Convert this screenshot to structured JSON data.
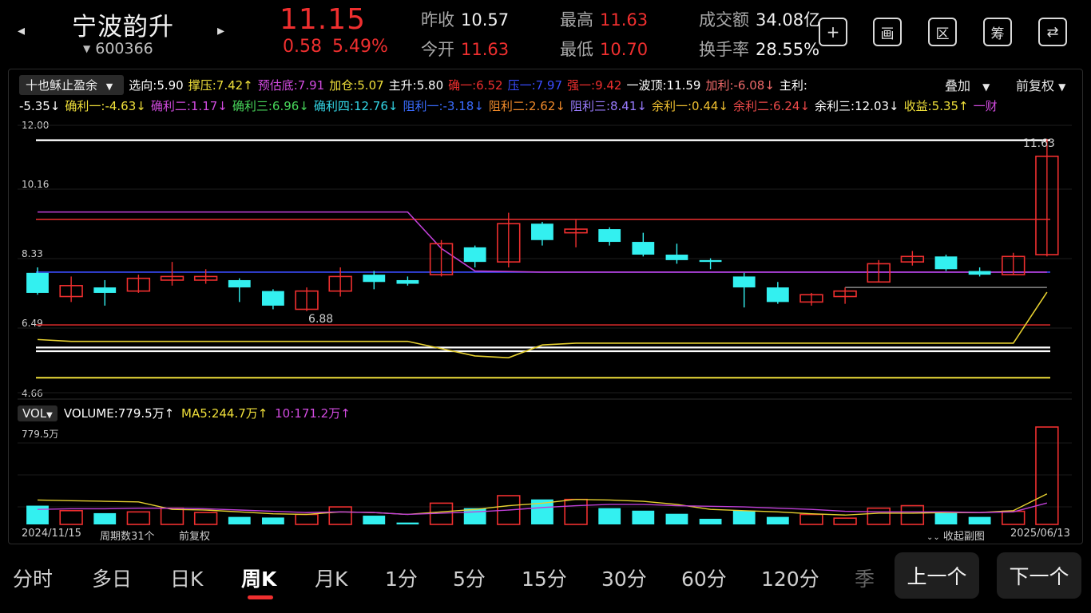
{
  "header": {
    "name": "宁波韵升",
    "code": "600366",
    "price": "11.15",
    "change": "0.58",
    "change_pct": "5.49%",
    "prev_close_label": "昨收",
    "prev_close": "10.57",
    "open_label": "今开",
    "open": "11.63",
    "high_label": "最高",
    "high": "11.63",
    "low_label": "最低",
    "low": "10.70",
    "turnover_label": "成交额",
    "turnover": "34.08亿",
    "turnover_rate_label": "换手率",
    "turnover_rate": "28.55%",
    "tools": [
      {
        "icon": "plus-icon",
        "glyph": "+"
      },
      {
        "icon": "draw-icon",
        "glyph": "画"
      },
      {
        "icon": "range-icon",
        "glyph": "区"
      },
      {
        "icon": "chips-icon",
        "glyph": "筹"
      },
      {
        "icon": "rotate-icon",
        "glyph": "⇄"
      }
    ]
  },
  "indicator": {
    "selector": "十也稣止盈余",
    "row1": [
      {
        "text": "选向:5.90",
        "color": "#ffffff"
      },
      {
        "text": "撑压:7.42↑",
        "color": "#f0e03a"
      },
      {
        "text": "预估底:7.91",
        "color": "#d24be0"
      },
      {
        "text": "加仓:5.07",
        "color": "#f0e03a"
      },
      {
        "text": "主升:5.80",
        "color": "#ffffff"
      },
      {
        "text": "确一:6.52",
        "color": "#ef2f2f"
      },
      {
        "text": "压一:7.97",
        "color": "#3a4cff"
      },
      {
        "text": "强一:9.42",
        "color": "#ef2f2f"
      },
      {
        "text": "一波顶:11.59",
        "color": "#ffffff"
      },
      {
        "text": "加利:-6.08↓",
        "color": "#ef6a6a"
      },
      {
        "text": "主利:",
        "color": "#ffffff"
      }
    ],
    "row2": [
      {
        "text": "-5.35↓",
        "color": "#ffffff"
      },
      {
        "text": "确利一:-4.63↓",
        "color": "#f0e03a"
      },
      {
        "text": "确利二:1.17↓",
        "color": "#d24be0"
      },
      {
        "text": "确利三:6.96↓",
        "color": "#47d65a"
      },
      {
        "text": "确利四:12.76↓",
        "color": "#33d6e6"
      },
      {
        "text": "阻利一:-3.18↓",
        "color": "#3a6cff"
      },
      {
        "text": "阻利二:2.62↓",
        "color": "#f08a2a"
      },
      {
        "text": "阻利三:8.41↓",
        "color": "#9a7cff"
      },
      {
        "text": "余利一:0.44↓",
        "color": "#f0c030"
      },
      {
        "text": "余利二:6.24↓",
        "color": "#ef4a4a"
      },
      {
        "text": "余利三:12.03↓",
        "color": "#ffffff"
      },
      {
        "text": "收益:5.35↑",
        "color": "#f0e03a"
      },
      {
        "text": "一财",
        "color": "#d24be0"
      }
    ],
    "overlay_label": "叠加",
    "adjust_label": "前复权"
  },
  "axis": {
    "y_labels": [
      "12.00",
      "10.16",
      "8.33",
      "6.49",
      "4.66"
    ],
    "high_mark": "11.63",
    "low_mark": "6.88"
  },
  "volume": {
    "selector": "VOL",
    "main": "VOLUME:779.5万↑",
    "ma5": "MA5:244.7万↑",
    "ma10": "10:171.2万↑",
    "max_label": "779.5万"
  },
  "footer": {
    "start_date": "2024/11/15",
    "period_count": "周期数31个",
    "adjust": "前复权",
    "collapse": "收起副图",
    "end_date": "2025/06/13"
  },
  "tabs": [
    "分时",
    "多日",
    "日K",
    "周K",
    "月K",
    "1分",
    "5分",
    "15分",
    "30分",
    "60分",
    "120分",
    "季"
  ],
  "active_tab": "周K",
  "pager": {
    "prev": "上一个",
    "next": "下一个"
  },
  "colors": {
    "up": "#ef2f2f",
    "down": "#33f0f0",
    "bg": "#000000"
  },
  "chart_data": {
    "type": "candlestick",
    "y_range": [
      4.66,
      12.0
    ],
    "candles": [
      {
        "o": 7.95,
        "h": 8.1,
        "l": 7.35,
        "c": 7.4
      },
      {
        "o": 7.3,
        "h": 7.85,
        "l": 7.15,
        "c": 7.6
      },
      {
        "o": 7.55,
        "h": 7.75,
        "l": 7.05,
        "c": 7.4
      },
      {
        "o": 7.45,
        "h": 7.9,
        "l": 7.4,
        "c": 7.8
      },
      {
        "o": 7.75,
        "h": 8.25,
        "l": 7.6,
        "c": 7.85
      },
      {
        "o": 7.75,
        "h": 8.05,
        "l": 7.65,
        "c": 7.85
      },
      {
        "o": 7.75,
        "h": 7.8,
        "l": 7.15,
        "c": 7.55
      },
      {
        "o": 7.45,
        "h": 7.5,
        "l": 6.95,
        "c": 7.05
      },
      {
        "o": 6.95,
        "h": 7.55,
        "l": 6.9,
        "c": 7.45
      },
      {
        "o": 7.45,
        "h": 8.1,
        "l": 7.3,
        "c": 7.85
      },
      {
        "o": 7.9,
        "h": 8.0,
        "l": 7.5,
        "c": 7.7
      },
      {
        "o": 7.75,
        "h": 7.85,
        "l": 7.6,
        "c": 7.65
      },
      {
        "o": 7.9,
        "h": 8.85,
        "l": 7.85,
        "c": 8.75
      },
      {
        "o": 8.65,
        "h": 8.7,
        "l": 8.1,
        "c": 8.25
      },
      {
        "o": 8.25,
        "h": 9.6,
        "l": 8.1,
        "c": 9.3
      },
      {
        "o": 9.3,
        "h": 9.35,
        "l": 8.7,
        "c": 8.85
      },
      {
        "o": 9.05,
        "h": 9.4,
        "l": 8.65,
        "c": 9.15
      },
      {
        "o": 9.15,
        "h": 9.2,
        "l": 8.7,
        "c": 8.8
      },
      {
        "o": 8.8,
        "h": 9.05,
        "l": 8.4,
        "c": 8.45
      },
      {
        "o": 8.45,
        "h": 8.75,
        "l": 8.2,
        "c": 8.3
      },
      {
        "o": 8.3,
        "h": 8.35,
        "l": 8.05,
        "c": 8.25
      },
      {
        "o": 7.85,
        "h": 7.95,
        "l": 7.0,
        "c": 7.55
      },
      {
        "o": 7.55,
        "h": 7.7,
        "l": 7.1,
        "c": 7.15
      },
      {
        "o": 7.15,
        "h": 7.4,
        "l": 7.05,
        "c": 7.35
      },
      {
        "o": 7.3,
        "h": 7.55,
        "l": 7.1,
        "c": 7.45
      },
      {
        "o": 7.7,
        "h": 8.3,
        "l": 7.7,
        "c": 8.2
      },
      {
        "o": 8.25,
        "h": 8.55,
        "l": 8.15,
        "c": 8.4
      },
      {
        "o": 8.4,
        "h": 8.45,
        "l": 8.0,
        "c": 8.05
      },
      {
        "o": 8.0,
        "h": 8.1,
        "l": 7.85,
        "c": 7.9
      },
      {
        "o": 7.9,
        "h": 8.5,
        "l": 7.9,
        "c": 8.4
      },
      {
        "o": 8.45,
        "h": 11.63,
        "l": 8.4,
        "c": 11.15
      }
    ],
    "volume": [
      150,
      110,
      90,
      100,
      130,
      95,
      60,
      55,
      80,
      140,
      70,
      15,
      170,
      130,
      230,
      200,
      200,
      130,
      110,
      85,
      45,
      110,
      60,
      80,
      50,
      130,
      150,
      90,
      60,
      105,
      779.5
    ],
    "vol_max": 779.5,
    "h_lines": [
      {
        "y": 11.59,
        "color": "#ffffff",
        "w": 2.4
      },
      {
        "y": 9.42,
        "color": "#ef2f2f",
        "w": 1.4
      },
      {
        "y": 7.97,
        "color": "#3a4cff",
        "w": 1.6
      },
      {
        "y": 6.52,
        "color": "#ef2f2f",
        "w": 1.4
      },
      {
        "y": 5.9,
        "color": "#ffffff",
        "w": 2.2
      },
      {
        "y": 5.8,
        "color": "#ffffff",
        "w": 2.2
      },
      {
        "y": 5.07,
        "color": "#f0e03a",
        "w": 2.0
      }
    ],
    "purple_line": [
      [
        0,
        9.62
      ],
      [
        11,
        9.62
      ],
      [
        12,
        8.62
      ],
      [
        13,
        8.0
      ],
      [
        15,
        7.97
      ],
      [
        30,
        7.97
      ]
    ],
    "yellow_line": [
      [
        0,
        6.12
      ],
      [
        1,
        6.07
      ],
      [
        11,
        6.07
      ],
      [
        13,
        5.67
      ],
      [
        14,
        5.62
      ],
      [
        15,
        5.97
      ],
      [
        16,
        6.02
      ],
      [
        29,
        6.02
      ],
      [
        30,
        7.42
      ]
    ],
    "gray_line": [
      [
        24,
        7.55
      ],
      [
        30,
        7.55
      ]
    ],
    "ma5_vol": [
      195,
      190,
      185,
      180,
      120,
      115,
      100,
      85,
      80,
      100,
      95,
      80,
      100,
      120,
      150,
      170,
      200,
      195,
      185,
      160,
      120,
      110,
      100,
      85,
      75,
      90,
      90,
      95,
      95,
      110,
      244.7
    ],
    "ma10_vol": [
      120,
      125,
      125,
      130,
      130,
      125,
      115,
      105,
      95,
      100,
      95,
      80,
      90,
      100,
      115,
      135,
      150,
      160,
      160,
      150,
      145,
      140,
      130,
      120,
      105,
      100,
      100,
      100,
      95,
      100,
      171.2
    ]
  }
}
